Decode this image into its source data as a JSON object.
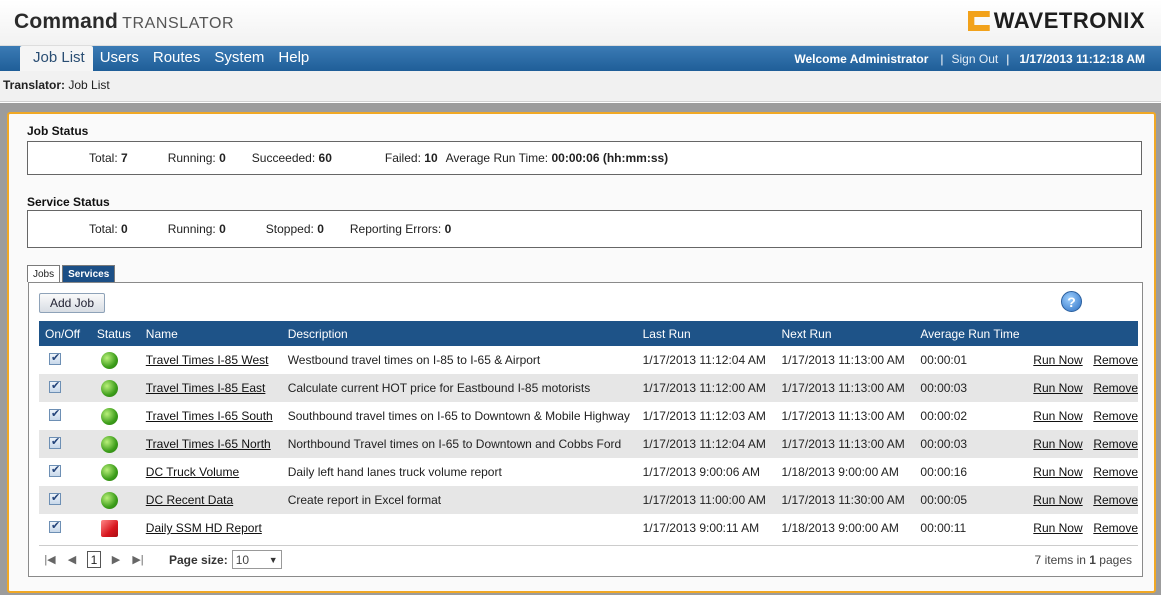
{
  "brand": {
    "name_bold": "Command",
    "name_sub": "TRANSLATOR",
    "logo_text": "WAVETRONIX"
  },
  "nav": {
    "items": [
      "Job List",
      "Users",
      "Routes",
      "System",
      "Help"
    ],
    "welcome": "Welcome Administrator",
    "sep1": "|",
    "signout": "Sign Out",
    "sep2": "|",
    "datetime": "1/17/2013 11:12:18 AM"
  },
  "breadcrumb": {
    "label": "Translator:",
    "page": "Job List"
  },
  "job_status": {
    "title": "Job Status",
    "total_label": "Total:",
    "total": "7",
    "running_label": "Running:",
    "running": "0",
    "succeeded_label": "Succeeded:",
    "succeeded": "60",
    "failed_label": "Failed:",
    "failed": "10",
    "avg_label": "Average Run Time:",
    "avg": "00:00:06 (hh:mm:ss)"
  },
  "service_status": {
    "title": "Service Status",
    "total_label": "Total:",
    "total": "0",
    "running_label": "Running:",
    "running": "0",
    "stopped_label": "Stopped:",
    "stopped": "0",
    "errors_label": "Reporting Errors:",
    "errors": "0"
  },
  "tabs": [
    "Jobs",
    "Services"
  ],
  "add_job_label": "Add Job",
  "help_icon": "question-icon",
  "columns": [
    "On/Off",
    "Status",
    "Name",
    "Description",
    "Last Run",
    "Next Run",
    "Average Run Time",
    "",
    ""
  ],
  "jobs": [
    {
      "status": "ok",
      "name": "Travel Times I-85 West",
      "description": "Westbound travel times on I-85 to I-65 & Airport",
      "last_run": "1/17/2013 11:12:04 AM",
      "next_run": "1/17/2013 11:13:00 AM",
      "avg": "00:00:01",
      "run": "Run Now",
      "remove": "Remove"
    },
    {
      "status": "ok",
      "name": "Travel Times I-85 East",
      "description": "Calculate current HOT price for Eastbound I-85 motorists",
      "last_run": "1/17/2013 11:12:00 AM",
      "next_run": "1/17/2013 11:13:00 AM",
      "avg": "00:00:03",
      "run": "Run Now",
      "remove": "Remove"
    },
    {
      "status": "ok",
      "name": "Travel Times I-65 South",
      "description": "Southbound travel times on I-65 to Downtown & Mobile Highway",
      "last_run": "1/17/2013 11:12:03 AM",
      "next_run": "1/17/2013 11:13:00 AM",
      "avg": "00:00:02",
      "run": "Run Now",
      "remove": "Remove"
    },
    {
      "status": "ok",
      "name": "Travel Times I-65 North",
      "description": "Northbound Travel times on I-65 to Downtown and Cobbs Ford",
      "last_run": "1/17/2013 11:12:04 AM",
      "next_run": "1/17/2013 11:13:00 AM",
      "avg": "00:00:03",
      "run": "Run Now",
      "remove": "Remove"
    },
    {
      "status": "ok",
      "name": "DC Truck Volume",
      "description": "Daily left hand lanes truck volume report",
      "last_run": "1/17/2013 9:00:06 AM",
      "next_run": "1/18/2013 9:00:00 AM",
      "avg": "00:00:16",
      "run": "Run Now",
      "remove": "Remove"
    },
    {
      "status": "ok",
      "name": "DC Recent Data",
      "description": "Create report in Excel format",
      "last_run": "1/17/2013 11:00:00 AM",
      "next_run": "1/17/2013 11:30:00 AM",
      "avg": "00:00:05",
      "run": "Run Now",
      "remove": "Remove"
    },
    {
      "status": "fail",
      "name": "Daily SSM HD Report",
      "description": "",
      "last_run": "1/17/2013 9:00:11 AM",
      "next_run": "1/18/2013 9:00:00 AM",
      "avg": "00:00:11",
      "run": "Run Now",
      "remove": "Remove"
    }
  ],
  "pager": {
    "current_page": "1",
    "page_size_label": "Page size:",
    "page_size": "10",
    "items_count": "7",
    "items_text": "items in",
    "pages_count": "1",
    "pages_text": "pages"
  }
}
